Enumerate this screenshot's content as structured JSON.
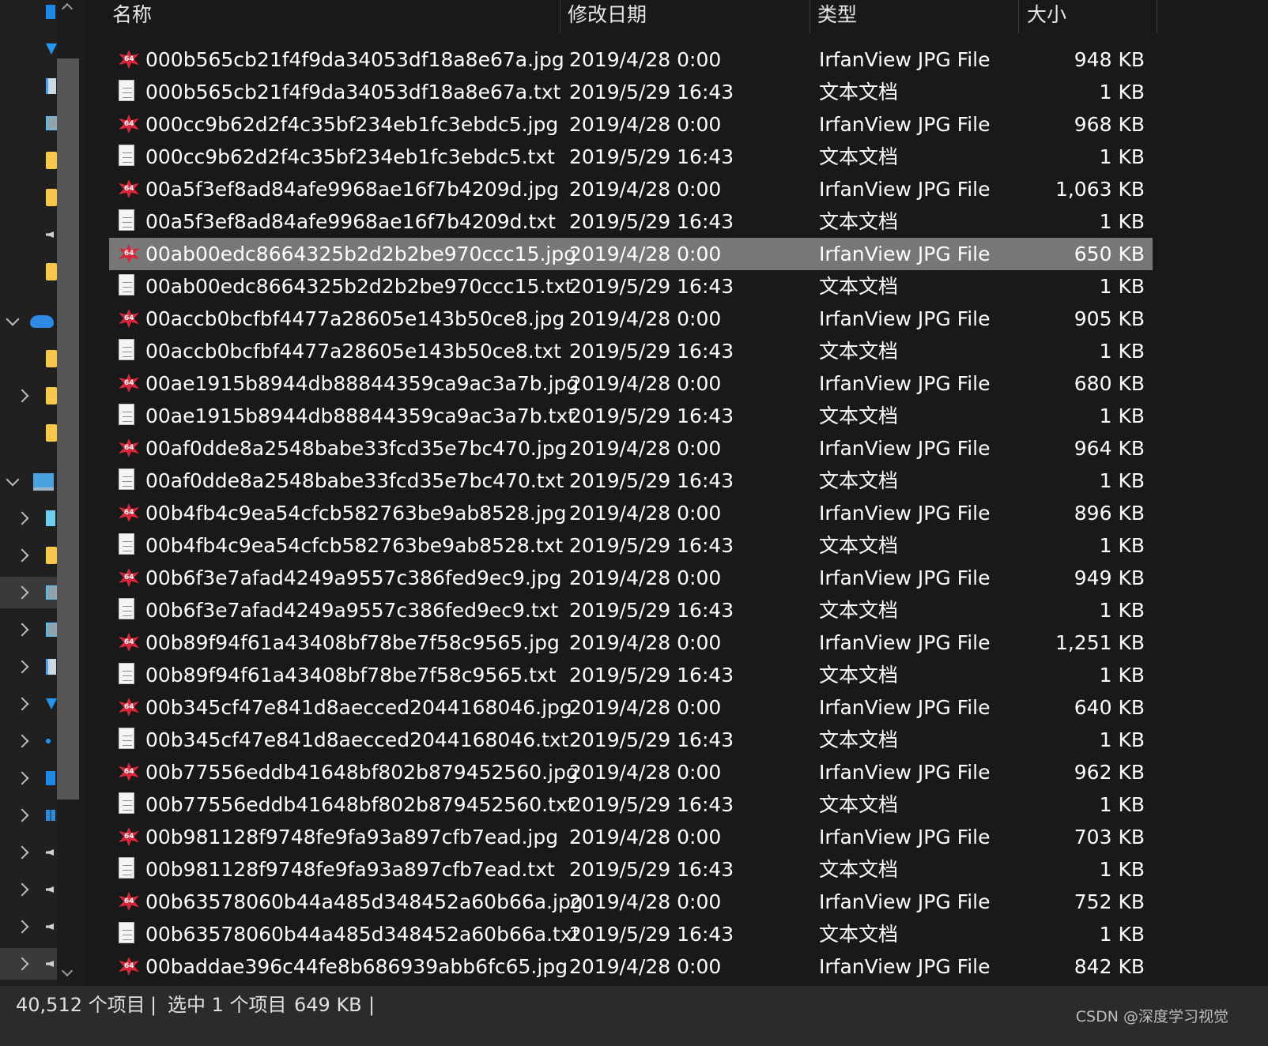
{
  "header": {
    "name": "名称",
    "date": "修改日期",
    "type": "类型",
    "size": "大小"
  },
  "files": [
    {
      "name": "000b565cb21f4f9da34053df18a8e67a.jpg",
      "date": "2019/4/28 0:00",
      "type": "IrfanView JPG File",
      "size": "948 KB",
      "icon": "irfanview-jpg-icon"
    },
    {
      "name": "000b565cb21f4f9da34053df18a8e67a.txt",
      "date": "2019/5/29 16:43",
      "type": "文本文档",
      "size": "1 KB",
      "icon": "text-file-icon"
    },
    {
      "name": "000cc9b62d2f4c35bf234eb1fc3ebdc5.jpg",
      "date": "2019/4/28 0:00",
      "type": "IrfanView JPG File",
      "size": "968 KB",
      "icon": "irfanview-jpg-icon"
    },
    {
      "name": "000cc9b62d2f4c35bf234eb1fc3ebdc5.txt",
      "date": "2019/5/29 16:43",
      "type": "文本文档",
      "size": "1 KB",
      "icon": "text-file-icon"
    },
    {
      "name": "00a5f3ef8ad84afe9968ae16f7b4209d.jpg",
      "date": "2019/4/28 0:00",
      "type": "IrfanView JPG File",
      "size": "1,063 KB",
      "icon": "irfanview-jpg-icon"
    },
    {
      "name": "00a5f3ef8ad84afe9968ae16f7b4209d.txt",
      "date": "2019/5/29 16:43",
      "type": "文本文档",
      "size": "1 KB",
      "icon": "text-file-icon"
    },
    {
      "name": "00ab00edc8664325b2d2b2be970ccc15.jpg",
      "date": "2019/4/28 0:00",
      "type": "IrfanView JPG File",
      "size": "650 KB",
      "icon": "irfanview-jpg-icon",
      "selected": true
    },
    {
      "name": "00ab00edc8664325b2d2b2be970ccc15.txt",
      "date": "2019/5/29 16:43",
      "type": "文本文档",
      "size": "1 KB",
      "icon": "text-file-icon"
    },
    {
      "name": "00accb0bcfbf4477a28605e143b50ce8.jpg",
      "date": "2019/4/28 0:00",
      "type": "IrfanView JPG File",
      "size": "905 KB",
      "icon": "irfanview-jpg-icon"
    },
    {
      "name": "00accb0bcfbf4477a28605e143b50ce8.txt",
      "date": "2019/5/29 16:43",
      "type": "文本文档",
      "size": "1 KB",
      "icon": "text-file-icon"
    },
    {
      "name": "00ae1915b8944db88844359ca9ac3a7b.jpg",
      "date": "2019/4/28 0:00",
      "type": "IrfanView JPG File",
      "size": "680 KB",
      "icon": "irfanview-jpg-icon"
    },
    {
      "name": "00ae1915b8944db88844359ca9ac3a7b.txt",
      "date": "2019/5/29 16:43",
      "type": "文本文档",
      "size": "1 KB",
      "icon": "text-file-icon"
    },
    {
      "name": "00af0dde8a2548babe33fcd35e7bc470.jpg",
      "date": "2019/4/28 0:00",
      "type": "IrfanView JPG File",
      "size": "964 KB",
      "icon": "irfanview-jpg-icon"
    },
    {
      "name": "00af0dde8a2548babe33fcd35e7bc470.txt",
      "date": "2019/5/29 16:43",
      "type": "文本文档",
      "size": "1 KB",
      "icon": "text-file-icon"
    },
    {
      "name": "00b4fb4c9ea54cfcb582763be9ab8528.jpg",
      "date": "2019/4/28 0:00",
      "type": "IrfanView JPG File",
      "size": "896 KB",
      "icon": "irfanview-jpg-icon"
    },
    {
      "name": "00b4fb4c9ea54cfcb582763be9ab8528.txt",
      "date": "2019/5/29 16:43",
      "type": "文本文档",
      "size": "1 KB",
      "icon": "text-file-icon"
    },
    {
      "name": "00b6f3e7afad4249a9557c386fed9ec9.jpg",
      "date": "2019/4/28 0:00",
      "type": "IrfanView JPG File",
      "size": "949 KB",
      "icon": "irfanview-jpg-icon"
    },
    {
      "name": "00b6f3e7afad4249a9557c386fed9ec9.txt",
      "date": "2019/5/29 16:43",
      "type": "文本文档",
      "size": "1 KB",
      "icon": "text-file-icon"
    },
    {
      "name": "00b89f94f61a43408bf78be7f58c9565.jpg",
      "date": "2019/4/28 0:00",
      "type": "IrfanView JPG File",
      "size": "1,251 KB",
      "icon": "irfanview-jpg-icon"
    },
    {
      "name": "00b89f94f61a43408bf78be7f58c9565.txt",
      "date": "2019/5/29 16:43",
      "type": "文本文档",
      "size": "1 KB",
      "icon": "text-file-icon"
    },
    {
      "name": "00b345cf47e841d8aecced2044168046.jpg",
      "date": "2019/4/28 0:00",
      "type": "IrfanView JPG File",
      "size": "640 KB",
      "icon": "irfanview-jpg-icon"
    },
    {
      "name": "00b345cf47e841d8aecced2044168046.txt",
      "date": "2019/5/29 16:43",
      "type": "文本文档",
      "size": "1 KB",
      "icon": "text-file-icon"
    },
    {
      "name": "00b77556eddb41648bf802b879452560.jpg",
      "date": "2019/4/28 0:00",
      "type": "IrfanView JPG File",
      "size": "962 KB",
      "icon": "irfanview-jpg-icon"
    },
    {
      "name": "00b77556eddb41648bf802b879452560.txt",
      "date": "2019/5/29 16:43",
      "type": "文本文档",
      "size": "1 KB",
      "icon": "text-file-icon"
    },
    {
      "name": "00b981128f9748fe9fa93a897cfb7ead.jpg",
      "date": "2019/4/28 0:00",
      "type": "IrfanView JPG File",
      "size": "703 KB",
      "icon": "irfanview-jpg-icon"
    },
    {
      "name": "00b981128f9748fe9fa93a897cfb7ead.txt",
      "date": "2019/5/29 16:43",
      "type": "文本文档",
      "size": "1 KB",
      "icon": "text-file-icon"
    },
    {
      "name": "00b63578060b44a485d348452a60b66a.jpg",
      "date": "2019/4/28 0:00",
      "type": "IrfanView JPG File",
      "size": "752 KB",
      "icon": "irfanview-jpg-icon"
    },
    {
      "name": "00b63578060b44a485d348452a60b66a.txt",
      "date": "2019/5/29 16:43",
      "type": "文本文档",
      "size": "1 KB",
      "icon": "text-file-icon"
    },
    {
      "name": "00baddae396c44fe8b686939abb6fc65.jpg",
      "date": "2019/4/28 0:00",
      "type": "IrfanView JPG File",
      "size": "842 KB",
      "icon": "irfanview-jpg-icon"
    }
  ],
  "status": {
    "item_count": "40,512 个项目",
    "separator": "|",
    "selected": "选中 1 个项目",
    "selected_size": "649 KB",
    "watermark": "CSDN @深度学习视觉"
  },
  "nav": {
    "items": [
      {
        "icon": "blue-folder-icon",
        "expander": "none"
      },
      {
        "icon": "downloads-icon",
        "expander": "none"
      },
      {
        "icon": "documents-icon",
        "expander": "none"
      },
      {
        "icon": "pictures-icon",
        "expander": "none"
      },
      {
        "icon": "folder-icon",
        "expander": "none"
      },
      {
        "icon": "folder-icon",
        "expander": "none"
      },
      {
        "icon": "speaker-icon",
        "expander": "none"
      },
      {
        "icon": "folder-icon",
        "expander": "none"
      },
      {
        "icon": "onedrive-cloud-icon",
        "expander": "expanded"
      },
      {
        "icon": "folder-icon",
        "expander": "none"
      },
      {
        "icon": "folder-icon",
        "expander": "collapsed"
      },
      {
        "icon": "folder-icon",
        "expander": "none"
      },
      {
        "icon": "this-pc-icon",
        "expander": "expanded"
      },
      {
        "icon": "3d-objects-icon",
        "expander": "collapsed"
      },
      {
        "icon": "folder-icon",
        "expander": "collapsed"
      },
      {
        "icon": "videos-icon",
        "expander": "collapsed",
        "highlighted": true
      },
      {
        "icon": "pictures-icon",
        "expander": "collapsed"
      },
      {
        "icon": "documents-icon",
        "expander": "collapsed"
      },
      {
        "icon": "downloads-icon",
        "expander": "collapsed"
      },
      {
        "icon": "blue-dot-icon",
        "expander": "collapsed"
      },
      {
        "icon": "blue-folder-icon",
        "expander": "collapsed"
      },
      {
        "icon": "windows-drive-icon",
        "expander": "collapsed"
      },
      {
        "icon": "speaker-icon",
        "expander": "collapsed"
      },
      {
        "icon": "speaker-icon",
        "expander": "collapsed"
      },
      {
        "icon": "speaker-icon",
        "expander": "collapsed"
      },
      {
        "icon": "speaker-icon",
        "expander": "collapsed",
        "highlighted": true
      }
    ]
  }
}
